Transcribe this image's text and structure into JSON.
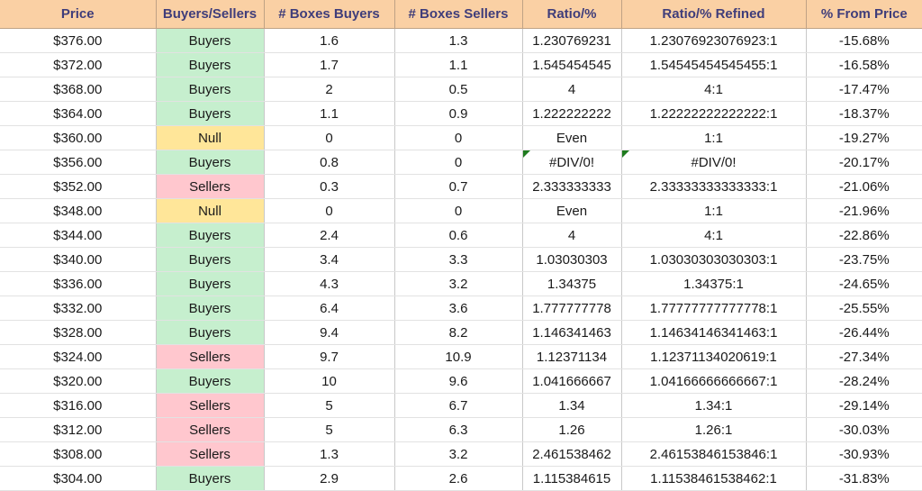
{
  "table": {
    "columns": [
      {
        "key": "price",
        "label": "Price"
      },
      {
        "key": "signal",
        "label": "Buyers/Sellers"
      },
      {
        "key": "boxes_buyers",
        "label": "# Boxes Buyers"
      },
      {
        "key": "boxes_sellers",
        "label": "# Boxes Sellers"
      },
      {
        "key": "ratio",
        "label": "Ratio/%"
      },
      {
        "key": "ratio_refined",
        "label": "Ratio/% Refined"
      },
      {
        "key": "pct_from_price",
        "label": "% From Price"
      }
    ],
    "colors": {
      "header_bg": "#FAD0A4",
      "header_text": "#3F3D7A",
      "buyers_bg": "#C6EFCE",
      "buyers_text": "#1C7A30",
      "sellers_bg": "#FFC7CE",
      "sellers_text": "#CE2240",
      "null_bg": "#FFE699",
      "null_text": "#9C6500",
      "error_marker": "#1E7B1E",
      "grid_line": "#C8C8C8",
      "body_text": "#1A1A1A"
    },
    "rows": [
      {
        "price": "$376.00",
        "signal": "Buyers",
        "signal_state": "buyers",
        "boxes_buyers": "1.6",
        "boxes_sellers": "1.3",
        "ratio": "1.230769231",
        "ratio_error": false,
        "ratio_refined": "1.23076923076923:1",
        "ratio_refined_error": false,
        "pct_from_price": "-15.68%"
      },
      {
        "price": "$372.00",
        "signal": "Buyers",
        "signal_state": "buyers",
        "boxes_buyers": "1.7",
        "boxes_sellers": "1.1",
        "ratio": "1.545454545",
        "ratio_error": false,
        "ratio_refined": "1.54545454545455:1",
        "ratio_refined_error": false,
        "pct_from_price": "-16.58%"
      },
      {
        "price": "$368.00",
        "signal": "Buyers",
        "signal_state": "buyers",
        "boxes_buyers": "2",
        "boxes_sellers": "0.5",
        "ratio": "4",
        "ratio_error": false,
        "ratio_refined": "4:1",
        "ratio_refined_error": false,
        "pct_from_price": "-17.47%"
      },
      {
        "price": "$364.00",
        "signal": "Buyers",
        "signal_state": "buyers",
        "boxes_buyers": "1.1",
        "boxes_sellers": "0.9",
        "ratio": "1.222222222",
        "ratio_error": false,
        "ratio_refined": "1.22222222222222:1",
        "ratio_refined_error": false,
        "pct_from_price": "-18.37%"
      },
      {
        "price": "$360.00",
        "signal": "Null",
        "signal_state": "null",
        "boxes_buyers": "0",
        "boxes_sellers": "0",
        "ratio": "Even",
        "ratio_error": false,
        "ratio_refined": "1:1",
        "ratio_refined_error": false,
        "pct_from_price": "-19.27%"
      },
      {
        "price": "$356.00",
        "signal": "Buyers",
        "signal_state": "buyers",
        "boxes_buyers": "0.8",
        "boxes_sellers": "0",
        "ratio": "#DIV/0!",
        "ratio_error": true,
        "ratio_refined": "#DIV/0!",
        "ratio_refined_error": true,
        "pct_from_price": "-20.17%"
      },
      {
        "price": "$352.00",
        "signal": "Sellers",
        "signal_state": "sellers",
        "boxes_buyers": "0.3",
        "boxes_sellers": "0.7",
        "ratio": "2.333333333",
        "ratio_error": false,
        "ratio_refined": "2.33333333333333:1",
        "ratio_refined_error": false,
        "pct_from_price": "-21.06%"
      },
      {
        "price": "$348.00",
        "signal": "Null",
        "signal_state": "null",
        "boxes_buyers": "0",
        "boxes_sellers": "0",
        "ratio": "Even",
        "ratio_error": false,
        "ratio_refined": "1:1",
        "ratio_refined_error": false,
        "pct_from_price": "-21.96%"
      },
      {
        "price": "$344.00",
        "signal": "Buyers",
        "signal_state": "buyers",
        "boxes_buyers": "2.4",
        "boxes_sellers": "0.6",
        "ratio": "4",
        "ratio_error": false,
        "ratio_refined": "4:1",
        "ratio_refined_error": false,
        "pct_from_price": "-22.86%"
      },
      {
        "price": "$340.00",
        "signal": "Buyers",
        "signal_state": "buyers",
        "boxes_buyers": "3.4",
        "boxes_sellers": "3.3",
        "ratio": "1.03030303",
        "ratio_error": false,
        "ratio_refined": "1.03030303030303:1",
        "ratio_refined_error": false,
        "pct_from_price": "-23.75%"
      },
      {
        "price": "$336.00",
        "signal": "Buyers",
        "signal_state": "buyers",
        "boxes_buyers": "4.3",
        "boxes_sellers": "3.2",
        "ratio": "1.34375",
        "ratio_error": false,
        "ratio_refined": "1.34375:1",
        "ratio_refined_error": false,
        "pct_from_price": "-24.65%"
      },
      {
        "price": "$332.00",
        "signal": "Buyers",
        "signal_state": "buyers",
        "boxes_buyers": "6.4",
        "boxes_sellers": "3.6",
        "ratio": "1.777777778",
        "ratio_error": false,
        "ratio_refined": "1.77777777777778:1",
        "ratio_refined_error": false,
        "pct_from_price": "-25.55%"
      },
      {
        "price": "$328.00",
        "signal": "Buyers",
        "signal_state": "buyers",
        "boxes_buyers": "9.4",
        "boxes_sellers": "8.2",
        "ratio": "1.146341463",
        "ratio_error": false,
        "ratio_refined": "1.14634146341463:1",
        "ratio_refined_error": false,
        "pct_from_price": "-26.44%"
      },
      {
        "price": "$324.00",
        "signal": "Sellers",
        "signal_state": "sellers",
        "boxes_buyers": "9.7",
        "boxes_sellers": "10.9",
        "ratio": "1.12371134",
        "ratio_error": false,
        "ratio_refined": "1.12371134020619:1",
        "ratio_refined_error": false,
        "pct_from_price": "-27.34%"
      },
      {
        "price": "$320.00",
        "signal": "Buyers",
        "signal_state": "buyers",
        "boxes_buyers": "10",
        "boxes_sellers": "9.6",
        "ratio": "1.041666667",
        "ratio_error": false,
        "ratio_refined": "1.04166666666667:1",
        "ratio_refined_error": false,
        "pct_from_price": "-28.24%"
      },
      {
        "price": "$316.00",
        "signal": "Sellers",
        "signal_state": "sellers",
        "boxes_buyers": "5",
        "boxes_sellers": "6.7",
        "ratio": "1.34",
        "ratio_error": false,
        "ratio_refined": "1.34:1",
        "ratio_refined_error": false,
        "pct_from_price": "-29.14%"
      },
      {
        "price": "$312.00",
        "signal": "Sellers",
        "signal_state": "sellers",
        "boxes_buyers": "5",
        "boxes_sellers": "6.3",
        "ratio": "1.26",
        "ratio_error": false,
        "ratio_refined": "1.26:1",
        "ratio_refined_error": false,
        "pct_from_price": "-30.03%"
      },
      {
        "price": "$308.00",
        "signal": "Sellers",
        "signal_state": "sellers",
        "boxes_buyers": "1.3",
        "boxes_sellers": "3.2",
        "ratio": "2.461538462",
        "ratio_error": false,
        "ratio_refined": "2.46153846153846:1",
        "ratio_refined_error": false,
        "pct_from_price": "-30.93%"
      },
      {
        "price": "$304.00",
        "signal": "Buyers",
        "signal_state": "buyers",
        "boxes_buyers": "2.9",
        "boxes_sellers": "2.6",
        "ratio": "1.115384615",
        "ratio_error": false,
        "ratio_refined": "1.11538461538462:1",
        "ratio_refined_error": false,
        "pct_from_price": "-31.83%"
      }
    ]
  }
}
